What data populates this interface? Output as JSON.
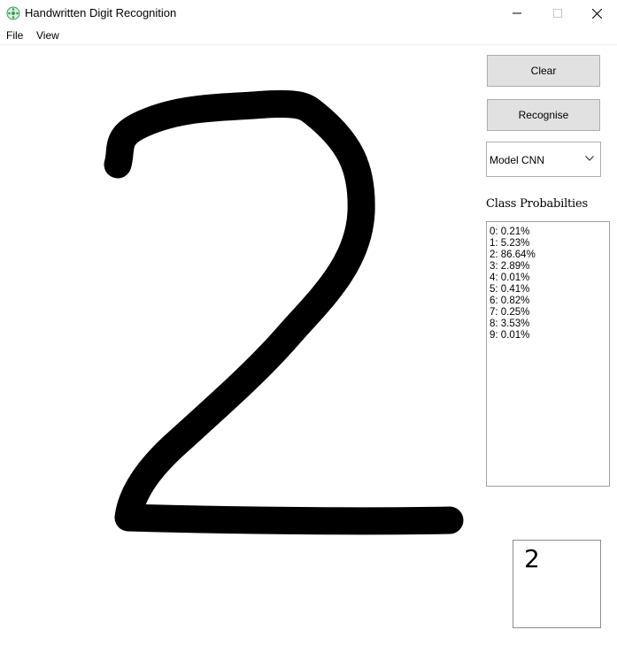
{
  "window": {
    "title": "Handwritten Digit Recognition",
    "icon": "app-logo-icon",
    "controls": [
      "minimize-icon",
      "maximize-icon",
      "close-icon"
    ]
  },
  "menu": {
    "file": "File",
    "view": "View"
  },
  "buttons": {
    "clear": "Clear",
    "recognise": "Recognise"
  },
  "model_select": {
    "value": "Model CNN"
  },
  "probabilities": {
    "label": "Class Probabilties",
    "items": [
      "0: 0.21%",
      "1: 5.23%",
      "2: 86.64%",
      "3: 2.89%",
      "4: 0.01%",
      "5: 0.41%",
      "6: 0.82%",
      "7: 0.25%",
      "8: 3.53%",
      "9: 0.01%"
    ]
  },
  "prediction": {
    "digit": "2"
  },
  "colors": {
    "stroke": "#000000",
    "button_bg": "#e1e1e1",
    "button_border": "#adadad"
  }
}
